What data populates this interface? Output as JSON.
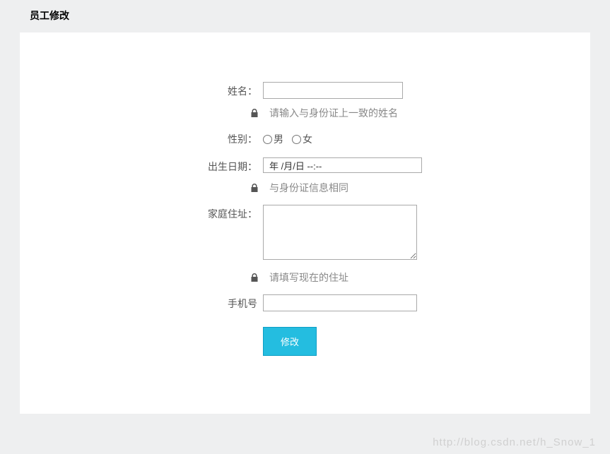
{
  "page": {
    "title": "员工修改"
  },
  "form": {
    "name": {
      "label": "姓名：",
      "value": "",
      "hint": "请输入与身份证上一致的姓名"
    },
    "gender": {
      "label": "性别：",
      "options": {
        "male": "男",
        "female": "女"
      }
    },
    "birthdate": {
      "label": "出生日期：",
      "value": "年 /月/日 --:--",
      "hint": "与身份证信息相同"
    },
    "address": {
      "label": "家庭住址：",
      "value": "",
      "hint": "请填写现在的住址"
    },
    "phone": {
      "label": "手机号",
      "value": ""
    },
    "submit": {
      "label": "修改"
    }
  },
  "watermark": "http://blog.csdn.net/h_Snow_1"
}
